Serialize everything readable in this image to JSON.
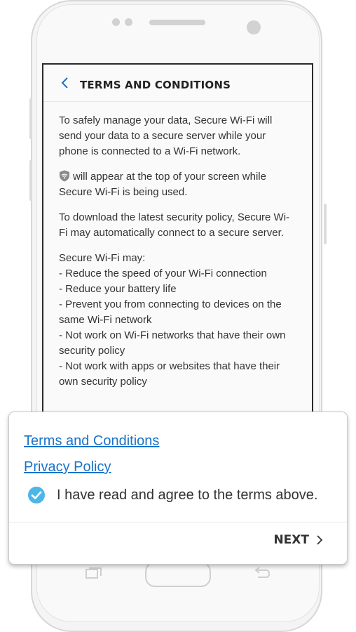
{
  "header": {
    "title": "TERMS AND CONDITIONS"
  },
  "body": {
    "paragraph1": "To safely manage your data, Secure Wi-Fi will send your data to a secure server while your phone is connected to a Wi-Fi network.",
    "paragraph2": "will appear at the top of your screen while Secure Wi-Fi is being used.",
    "paragraph3": "To download the latest security policy, Secure Wi-Fi may automatically connect to a secure server.",
    "may_heading": "Secure Wi-Fi may:",
    "may_items": [
      " - Reduce the speed of your Wi-Fi connection",
      " - Reduce your battery life",
      " - Prevent you from connecting to devices on the same Wi-Fi network",
      " - Not work on Wi-Fi networks that have their own security policy",
      " - Not work with apps or websites that have their own security policy"
    ]
  },
  "agreement": {
    "terms_link": "Terms and Conditions",
    "privacy_link": "Privacy Policy",
    "checkbox_label": "I have read and agree to the terms above.",
    "checkbox_checked": true,
    "next_label": "NEXT"
  },
  "icons": {
    "back": "chevron-left-icon",
    "shield": "shield-wifi-icon",
    "check": "check-circle-icon",
    "next": "chevron-right-icon"
  },
  "colors": {
    "accent": "#1a73c9",
    "check": "#4db6e8"
  }
}
